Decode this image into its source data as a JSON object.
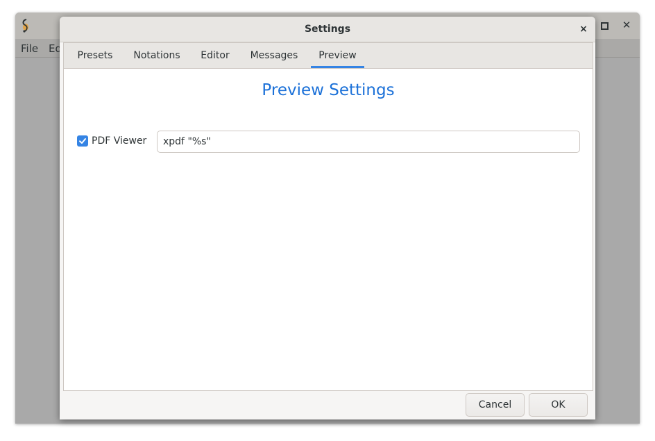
{
  "main_window": {
    "menu": [
      "File",
      "Ed"
    ]
  },
  "dialog": {
    "title": "Settings",
    "close_glyph": "×",
    "tabs": [
      {
        "label": "Presets",
        "active": false
      },
      {
        "label": "Notations",
        "active": false
      },
      {
        "label": "Editor",
        "active": false
      },
      {
        "label": "Messages",
        "active": false
      },
      {
        "label": "Preview",
        "active": true
      }
    ],
    "heading": "Preview Settings",
    "pdf_viewer": {
      "label": "PDF Viewer",
      "checked": true,
      "value": "xpdf \"%s\""
    },
    "buttons": {
      "cancel": "Cancel",
      "ok": "OK"
    }
  },
  "icons": {
    "app": "app-logo-icon",
    "maximize": "maximize-icon",
    "close": "close-icon",
    "check": "checkmark-icon"
  },
  "colors": {
    "accent": "#3584e4",
    "heading": "#1c71d8",
    "dim_overlay": "#a9a9a9"
  }
}
